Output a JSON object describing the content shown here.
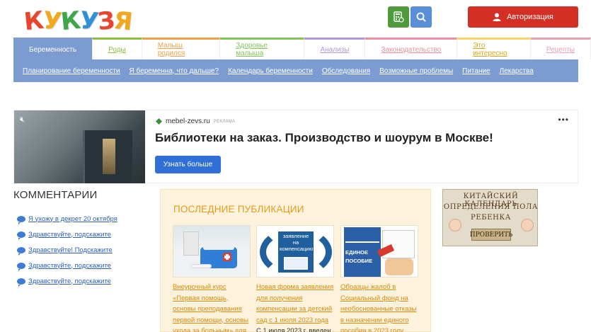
{
  "header": {
    "logo_text": "КУКУЗЯ",
    "calculator_icon": "calculator-icon",
    "search_icon": "search-icon",
    "auth_label": "Авторизация",
    "auth_icon": "user-icon",
    "logo_colors": [
      "#e8442e",
      "#f2a81d",
      "#3fa64a",
      "#2f8fd8",
      "#e8442e",
      "#f2a81d"
    ]
  },
  "tabs": [
    {
      "label": "Беременность",
      "color": "#7c9bd1"
    },
    {
      "label": "Роды",
      "color": "#8bbf3f"
    },
    {
      "label": "Малыш родился",
      "color": "#f0a04a"
    },
    {
      "label": "Здоровье малыша",
      "color": "#7fc45a"
    },
    {
      "label": "Анализы",
      "color": "#b497d6"
    },
    {
      "label": "Законодательство",
      "color": "#e98fa0"
    },
    {
      "label": "Это интересно",
      "color": "#f6d36a"
    },
    {
      "label": "Рецепты",
      "color": "#e9a0b0"
    }
  ],
  "subnav": [
    "Планирование беременности",
    "Я беременна, что дальше?",
    "Календарь беременности",
    "Обследования",
    "Возможные проблемы",
    "Питание",
    "Лекарства"
  ],
  "ad": {
    "source": "mebel-zevs.ru",
    "tag": "РЕКЛАМА",
    "title": "Библиотеки на заказ. Производство и шоурум в Москве!",
    "button": "Узнать больше",
    "mute_icon": "speaker-muted-icon",
    "more_icon": "more-dots-icon"
  },
  "comments": {
    "title": "КОММЕНТАРИИ",
    "items": [
      "Я ухожу в декрет 20 октября",
      "Здравствуйте, подскажите",
      "Здравствуйте! Подскажите",
      "Здравствуйте, подскажите",
      "Здравствуйте, подскажите"
    ]
  },
  "publications": {
    "title": "ПОСЛЕДНИЕ ПУБЛИКАЦИИ",
    "items": [
      {
        "link": "Внеурочный курс «Первая помощь, основы преподавания первой помощи, основы ухода за больным» для",
        "text": "",
        "image_label": ""
      },
      {
        "link": "Новая форма заявления для получения компенсации за детский сад с 1 июля 2023 года",
        "text": "С 1 июля 2023 г. введен",
        "image_label": "заявление на компенсацию"
      },
      {
        "link": "Образцы жалоб в Социальный фонд на необоснованные отказы в назначении единого пособия в 2023 году",
        "text": "",
        "image_label": "ЕДИНОЕ ПОСОБИЕ"
      }
    ]
  },
  "side_banner": {
    "line1": "КИТАЙСКИЙ КАЛЕНДАРЬ",
    "line2": "ОПРЕДЕЛЕНИЯ ПОЛА",
    "line3": "РЕБЕНКА",
    "button": "ПРОВЕРИТЬ"
  }
}
